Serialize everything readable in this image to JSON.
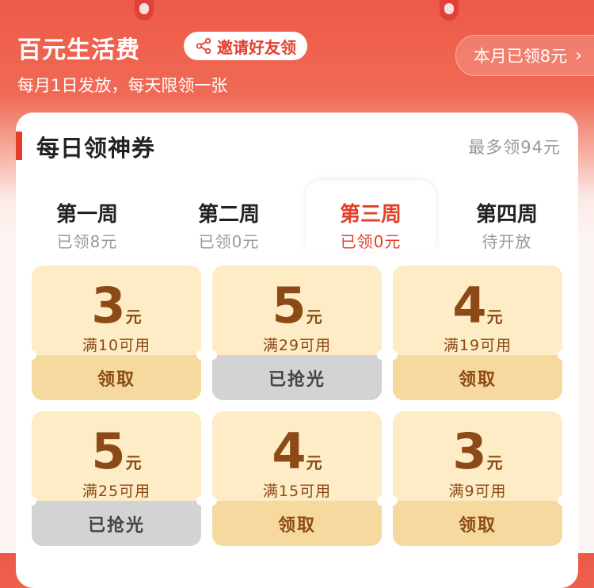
{
  "header": {
    "title": "百元生活费",
    "invite_label": "邀请好友领",
    "subtitle": "每月1日发放，每天限领一张",
    "month_claimed": "本月已领8元"
  },
  "card": {
    "title": "每日领神券",
    "max_note": "最多领94元"
  },
  "tabs": [
    {
      "label": "第一周",
      "status": "已领8元"
    },
    {
      "label": "第二周",
      "status": "已领0元"
    },
    {
      "label": "第三周",
      "status": "已领0元"
    },
    {
      "label": "第四周",
      "status": "待开放"
    }
  ],
  "coupons": [
    {
      "amount": "3",
      "unit": "元",
      "condition": "满10可用",
      "action": "领取"
    },
    {
      "amount": "5",
      "unit": "元",
      "condition": "满29可用",
      "action": "已抢光"
    },
    {
      "amount": "4",
      "unit": "元",
      "condition": "满19可用",
      "action": "领取"
    },
    {
      "amount": "5",
      "unit": "元",
      "condition": "满25可用",
      "action": "已抢光"
    },
    {
      "amount": "4",
      "unit": "元",
      "condition": "满15可用",
      "action": "领取"
    },
    {
      "amount": "3",
      "unit": "元",
      "condition": "满9可用",
      "action": "领取"
    }
  ],
  "colors": {
    "accent": "#e2402c",
    "coupon_bg": "#fdecc6",
    "coupon_btn": "#f6d99f",
    "sold_out_btn": "#d3d3d3",
    "coupon_text": "#8b4a16"
  }
}
